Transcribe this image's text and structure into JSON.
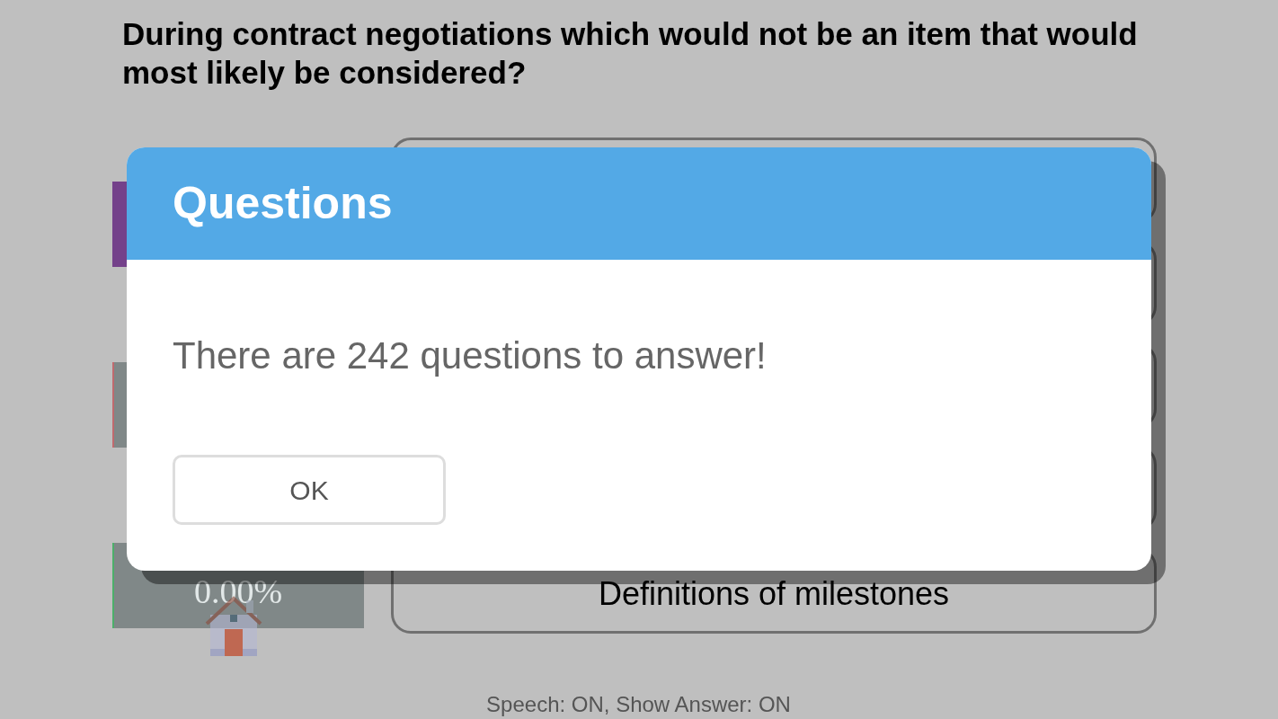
{
  "question": "During contract negotiations which would not be an item that would most likely be considered?",
  "stats": [
    {
      "kind": "filled",
      "color": "#74418a"
    },
    {
      "kind": "striped",
      "color": "#c06a6e"
    },
    {
      "kind": "striped",
      "color": "#4caf6a",
      "value": "0.00%"
    }
  ],
  "answer_options": [
    {
      "kind": "blank"
    },
    {
      "kind": "blank"
    },
    {
      "kind": "blank"
    },
    {
      "kind": "blank"
    },
    {
      "kind": "text",
      "label": "Definitions of milestones"
    }
  ],
  "status_bar": "Speech: ON, Show Answer: ON",
  "dialog": {
    "title": "Questions",
    "message": "There are 242 questions to answer!",
    "buttons": [
      "OK"
    ]
  }
}
